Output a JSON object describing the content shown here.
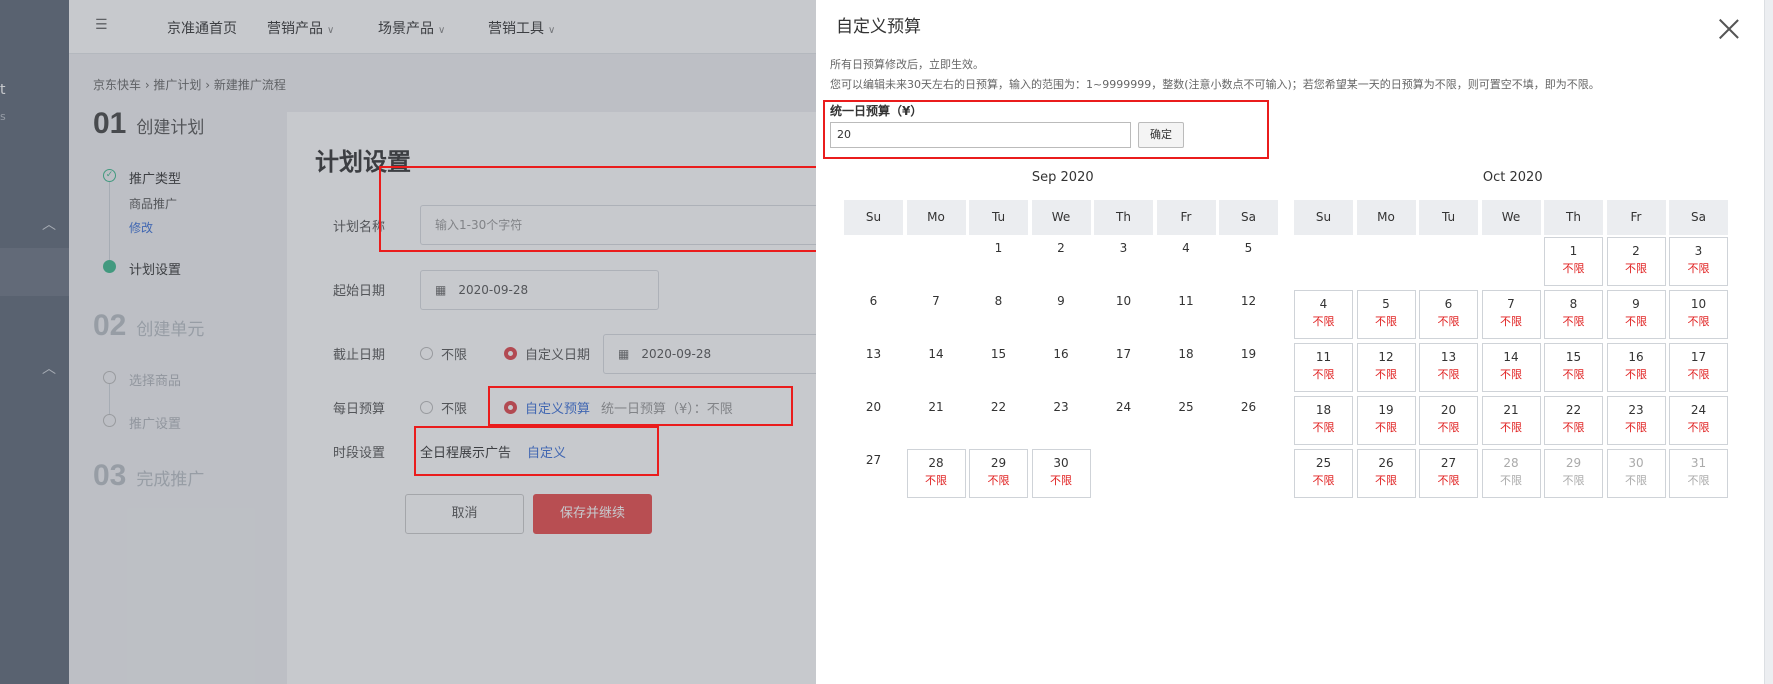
{
  "sidebar": {
    "frag1": "t",
    "frag2": "s"
  },
  "topnav": {
    "items": [
      "京准通首页",
      "营销产品",
      "场景产品",
      "营销工具"
    ]
  },
  "breadcrumb": "京东快车 › 推广计划 › 新建推广流程",
  "steps": {
    "s1_num": "01",
    "s1_title": "创建计划",
    "s1_sub1": "推广类型",
    "s1_sub2": "商品推广",
    "s1_sub3": "修改",
    "s1_sub4": "计划设置",
    "s2_num": "02",
    "s2_title": "创建单元",
    "s2_sub1": "选择商品",
    "s2_sub2": "推广设置",
    "s3_num": "03",
    "s3_title": "完成推广"
  },
  "form": {
    "title": "计划设置",
    "name_label": "计划名称",
    "name_placeholder": "输入1-30个字符",
    "start_label": "起始日期",
    "start_value": "2020-09-28",
    "end_label": "截止日期",
    "end_opt1": "不限",
    "end_opt2": "自定义日期",
    "end_value": "2020-09-28",
    "budget_label": "每日预算",
    "budget_opt1": "不限",
    "budget_opt2": "自定义预算",
    "budget_hint": "统一日预算（¥）：不限",
    "time_label": "时段设置",
    "time_value": "全日程展示广告",
    "time_link": "自定义",
    "cancel": "取消",
    "save": "保存并继续"
  },
  "drawer": {
    "title": "自定义预算",
    "note1": "所有日预算修改后，立即生效。",
    "note2": "您可以编辑未来30天左右的日预算，输入的范围为：1~9999999，整数(注意小数点不可输入)；若您希望某一天的日预算为不限，则可置空不填，即为不限。",
    "budget_label": "统一日预算（¥）",
    "budget_value": "20",
    "ok": "确定"
  },
  "calendar": {
    "dow": [
      "Su",
      "Mo",
      "Tu",
      "We",
      "Th",
      "Fr",
      "Sa"
    ],
    "unlimited": "不限",
    "months": [
      {
        "title": "Sep 2020",
        "offset": 2,
        "days": 30,
        "boxed_from": 28,
        "boxed_to": 30,
        "past_from": 0
      },
      {
        "title": "Oct 2020",
        "offset": 4,
        "days": 31,
        "boxed_from": 1,
        "boxed_to": 31,
        "past_from": 28
      }
    ]
  }
}
